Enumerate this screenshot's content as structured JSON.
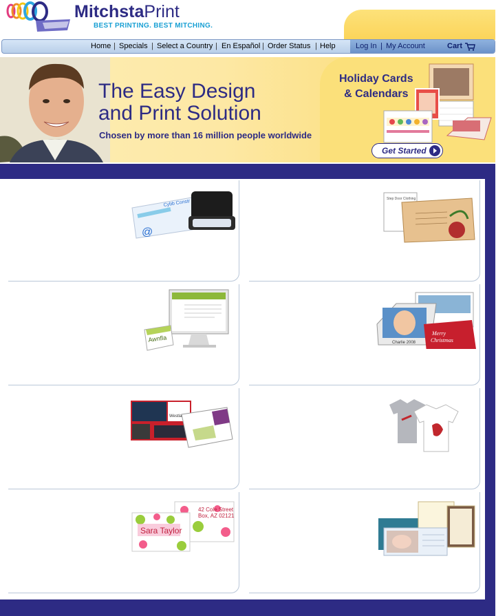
{
  "brand": {
    "name_part1": "Mitchsta",
    "name_part2": "Print",
    "tagline": "BEST PRINTING. BEST MITCHING."
  },
  "nav": {
    "links": [
      "Home",
      "Specials",
      "Select a Country",
      "En Español",
      "Order Status",
      "Help"
    ],
    "login": "Log In",
    "account": "My Account",
    "cart": "Cart"
  },
  "hero": {
    "headline_line1": "The Easy Design",
    "headline_line2": "and Print Solution",
    "subline": "Chosen by more than 16 million people worldwide",
    "promo_title_line1": "Holiday Cards",
    "promo_title_line2": "& Calendars",
    "cta": "Get Started"
  },
  "products": {
    "business_cards": {
      "card_text": "Cybb Constr",
      "email_symbol": "@"
    },
    "stationery": {
      "card_text": "Step Door Clothing"
    },
    "website": {
      "brand_text": "Awnfla"
    },
    "photo_calendar": {
      "caption": "Charlie 2008",
      "greeting_line1": "Merry",
      "greeting_line2": "Christmas"
    },
    "realestate": {
      "header_text": "Westlake"
    },
    "apparel": {},
    "labels": {
      "name_text": "Sara Taylor",
      "address_line1": "42 Cole Street",
      "address_line2": "Box, AZ 02121"
    },
    "announcements": {}
  },
  "colors": {
    "brand_navy": "#2d2b84",
    "brand_blue": "#4a77b8",
    "hero_gold": "#fbd968",
    "tagline_cyan": "#1aa0d4"
  }
}
